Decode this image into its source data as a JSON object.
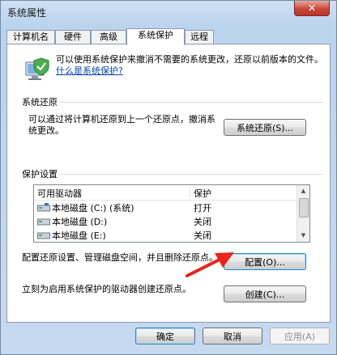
{
  "window": {
    "title": "系统属性",
    "close_label": "✕"
  },
  "tabs": [
    {
      "label": "计算机名"
    },
    {
      "label": "硬件"
    },
    {
      "label": "高级"
    },
    {
      "label": "系统保护",
      "active": true
    },
    {
      "label": "远程"
    }
  ],
  "intro": {
    "text": "可以使用系统保护来撤消不需要的系统更改，还原以前版本的文件。",
    "link": "什么是系统保护?",
    "icon": "computer-shield-icon"
  },
  "restore_group": {
    "title": "系统还原",
    "text": "可以通过将计算机还原到上一个还原点，撤消系统更改。",
    "button_label": "系统还原(S)..."
  },
  "protection_group": {
    "title": "保护设置",
    "columns": [
      "可用驱动器",
      "保护"
    ],
    "drives": [
      {
        "name": "本地磁盘 (C:) (系统)",
        "protection": "打开",
        "icon": "system-drive-icon"
      },
      {
        "name": "本地磁盘 (D:)",
        "protection": "关闭",
        "icon": "drive-icon"
      },
      {
        "name": "本地磁盘 (E:)",
        "protection": "关闭",
        "icon": "drive-icon"
      }
    ],
    "configure_text": "配置还原设置、管理磁盘空间，并且删除还原点。",
    "configure_button": "配置(O)...",
    "create_text": "立刻为启用系统保护的驱动器创建还原点。",
    "create_button": "创建(C)..."
  },
  "footer": {
    "ok_label": "确定",
    "cancel_label": "取消",
    "apply_label": "应用(A)"
  },
  "colors": {
    "link": "#0645ad",
    "annotation_arrow": "#e8231c"
  }
}
